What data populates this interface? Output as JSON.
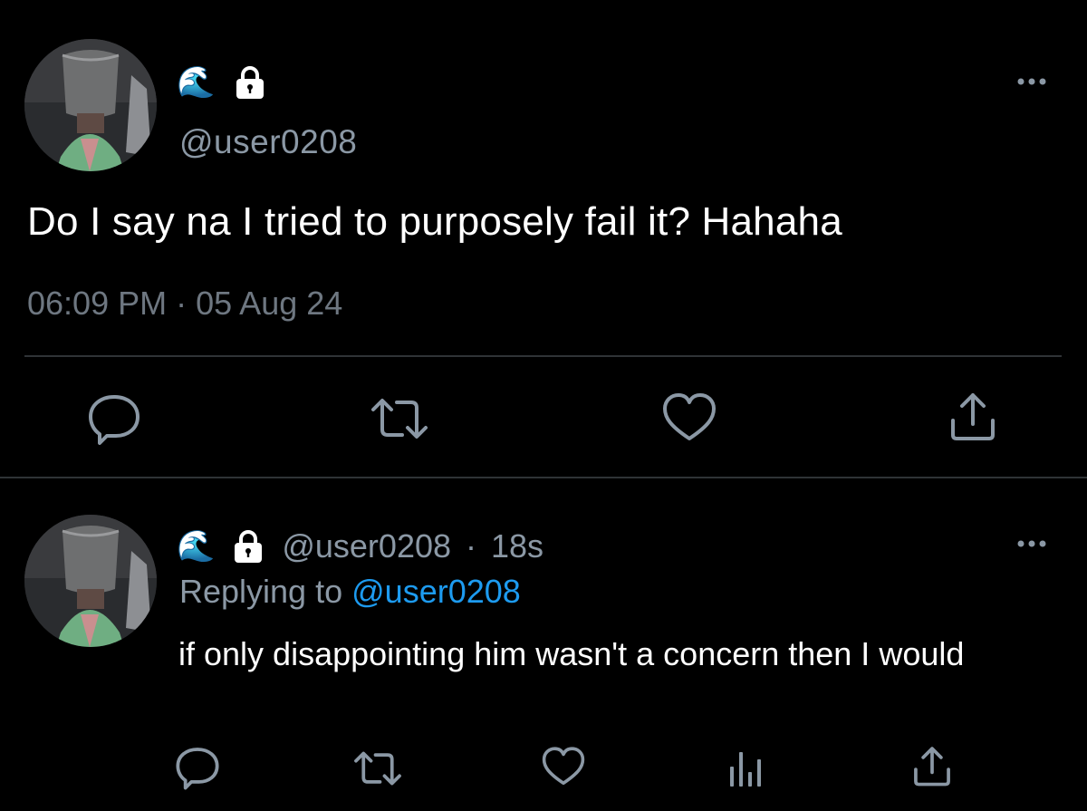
{
  "main_tweet": {
    "display_name_emoji": "🌊",
    "handle": "@user0208",
    "text": "Do I say na I tried to purposely fail it? Hahaha",
    "time": "06:09 PM",
    "separator": "·",
    "date": "05 Aug 24",
    "actions": [
      "reply-icon",
      "retweet-icon",
      "like-icon",
      "share-icon"
    ]
  },
  "reply": {
    "display_name_emoji": "🌊",
    "handle": "@user0208",
    "separator": "·",
    "age": "18s",
    "replying_prefix": "Replying to",
    "replying_to": "@user0208",
    "text": "if only disappointing him wasn't a concern then I would",
    "actions": [
      "reply-icon",
      "retweet-icon",
      "like-icon",
      "analytics-icon",
      "share-icon"
    ]
  },
  "colors": {
    "background": "#000000",
    "text_primary": "#ffffff",
    "text_secondary": "#8b98a5",
    "link": "#1d9bf0",
    "divider": "#2f3336"
  }
}
